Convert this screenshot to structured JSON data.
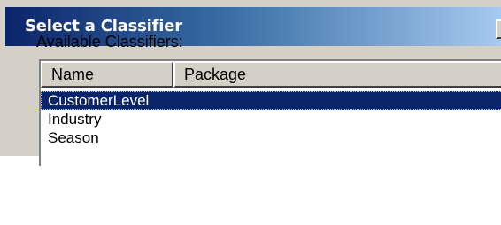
{
  "window": {
    "title": "Select a Classifier"
  },
  "form": {
    "available_label": "Available Classifiers:"
  },
  "list": {
    "columns": [
      "Name",
      "Package"
    ],
    "rows": [
      {
        "name": "CustomerLevel",
        "package": "",
        "selected": true
      },
      {
        "name": "Industry",
        "package": "",
        "selected": false
      },
      {
        "name": "Season",
        "package": "",
        "selected": false
      }
    ]
  },
  "colors": {
    "titlebar_start": "#0a246a",
    "titlebar_end": "#a6caf0",
    "selection": "#0a246a",
    "face": "#d4d0c8"
  },
  "icons": {
    "close": "close-icon"
  }
}
